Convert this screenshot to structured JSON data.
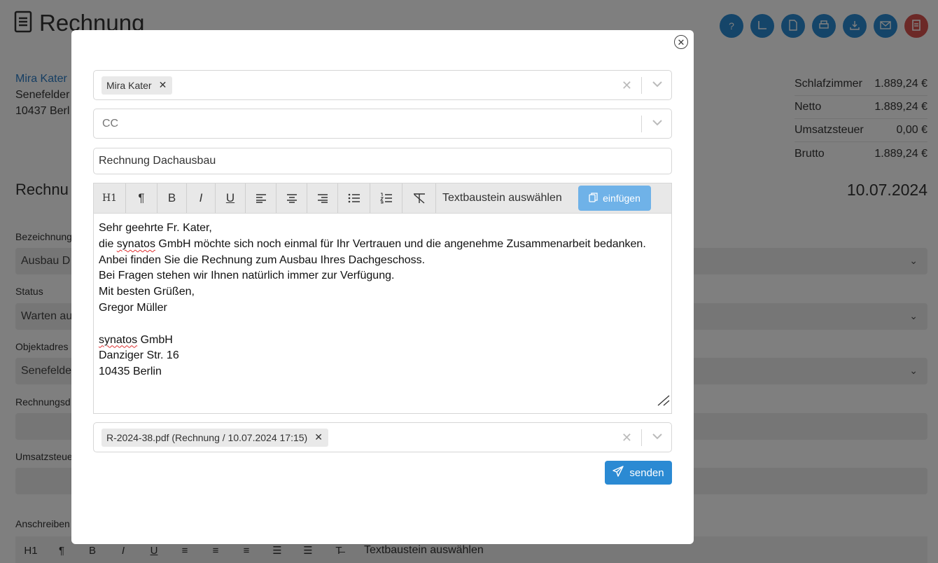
{
  "page": {
    "title": "Rechnung",
    "customer": {
      "name": "Mira Kater",
      "street": "Senefelder",
      "city": "10437 Berl"
    },
    "totals": [
      {
        "label": "Schlafzimmer",
        "value": "1.889,24 €"
      },
      {
        "label": "Netto",
        "value": "1.889,24 €"
      },
      {
        "label": "Umsatzsteuer",
        "value": "0,00 €"
      },
      {
        "label": "Brutto",
        "value": "1.889,24 €"
      }
    ],
    "section_title": "Rechnu",
    "date": "10.07.2024",
    "fields": [
      {
        "label": "Bezeichnung",
        "value": "Ausbau D"
      },
      {
        "label": "Status",
        "value": "Warten au"
      },
      {
        "label": "Objektadres",
        "value": "Senefelde"
      },
      {
        "label": "Rechnungsd",
        "value": ""
      },
      {
        "label": "Umsatzsteue",
        "value": ""
      },
      {
        "label": "Anschreiben",
        "value": ""
      }
    ],
    "bg_toolbar_select": "Textbaustein auswählen",
    "action_icons": [
      "help-icon",
      "ruler-icon",
      "pdf-icon",
      "print-icon",
      "download-icon",
      "mail-icon",
      "document-icon"
    ],
    "colors": {
      "primary": "#2b8ad3",
      "danger": "#d9534f",
      "link": "#2b7cc7"
    }
  },
  "modal": {
    "recipient_tag": "Mira Kater",
    "cc_placeholder": "CC",
    "subject": "Rechnung Dachausbau",
    "toolbar": {
      "h1": "H1",
      "paragraph": "¶",
      "bold": "B",
      "italic": "I",
      "underline": "U",
      "snippet_select": "Textbaustein auswählen",
      "insert_label": "einfügen"
    },
    "body_lines": [
      "Sehr geehrte Fr. Kater,",
      "die synatos GmbH möchte sich noch einmal für Ihr Vertrauen und die angenehme Zusammenarbeit bedanken.",
      "Anbei finden Sie die Rechnung zum Ausbau Ihres Dachgeschoss.",
      "Bei Fragen stehen wir Ihnen natürlich immer zur Verfügung.",
      "Mit besten Grüßen,",
      "Gregor Müller",
      "",
      "synatos GmbH",
      "Danziger Str. 16",
      "10435 Berlin"
    ],
    "attachment_tag": "R-2024-38.pdf (Rechnung / 10.07.2024 17:15)",
    "send_label": "senden"
  }
}
